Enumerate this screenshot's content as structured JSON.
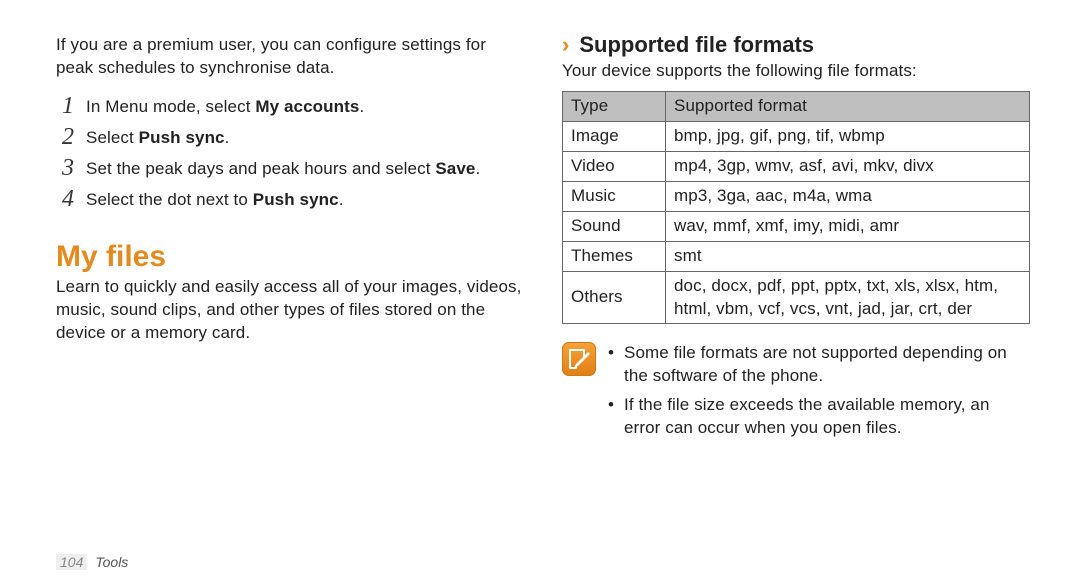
{
  "left": {
    "intro": "If you are a premium user, you can configure settings for peak schedules to synchronise data.",
    "steps": [
      {
        "num": "1",
        "pre": "In Menu mode, select ",
        "bold": "My accounts",
        "post": "."
      },
      {
        "num": "2",
        "pre": "Select ",
        "bold": "Push sync",
        "post": "."
      },
      {
        "num": "3",
        "pre": "Set the peak days and peak hours and select ",
        "bold": "Save",
        "post": "."
      },
      {
        "num": "4",
        "pre": "Select the dot next to ",
        "bold": "Push sync",
        "post": "."
      }
    ],
    "section_title": "My files",
    "section_desc": "Learn to quickly and easily access all of your images, videos, music, sound clips, and other types of files stored on the device or a memory card."
  },
  "right": {
    "chevron": "›",
    "sub_title": "Supported file formats",
    "intro": "Your device supports the following file formats:",
    "table": {
      "head": {
        "c1": "Type",
        "c2": "Supported format"
      },
      "rows": [
        {
          "c1": "Image",
          "c2": "bmp, jpg, gif, png, tif, wbmp"
        },
        {
          "c1": "Video",
          "c2": "mp4, 3gp, wmv, asf, avi, mkv, divx"
        },
        {
          "c1": "Music",
          "c2": "mp3, 3ga, aac, m4a, wma"
        },
        {
          "c1": "Sound",
          "c2": "wav, mmf, xmf, imy, midi, amr"
        },
        {
          "c1": "Themes",
          "c2": "smt"
        },
        {
          "c1": "Others",
          "c2": "doc, docx, pdf, ppt, pptx, txt, xls, xlsx, htm, html, vbm, vcf, vcs, vnt, jad, jar, crt, der"
        }
      ]
    },
    "notes": [
      "Some file formats are not supported depending on the software of the phone.",
      "If the file size exceeds the available memory, an error can occur when you open files."
    ]
  },
  "footer": {
    "page": "104",
    "section": "Tools"
  }
}
